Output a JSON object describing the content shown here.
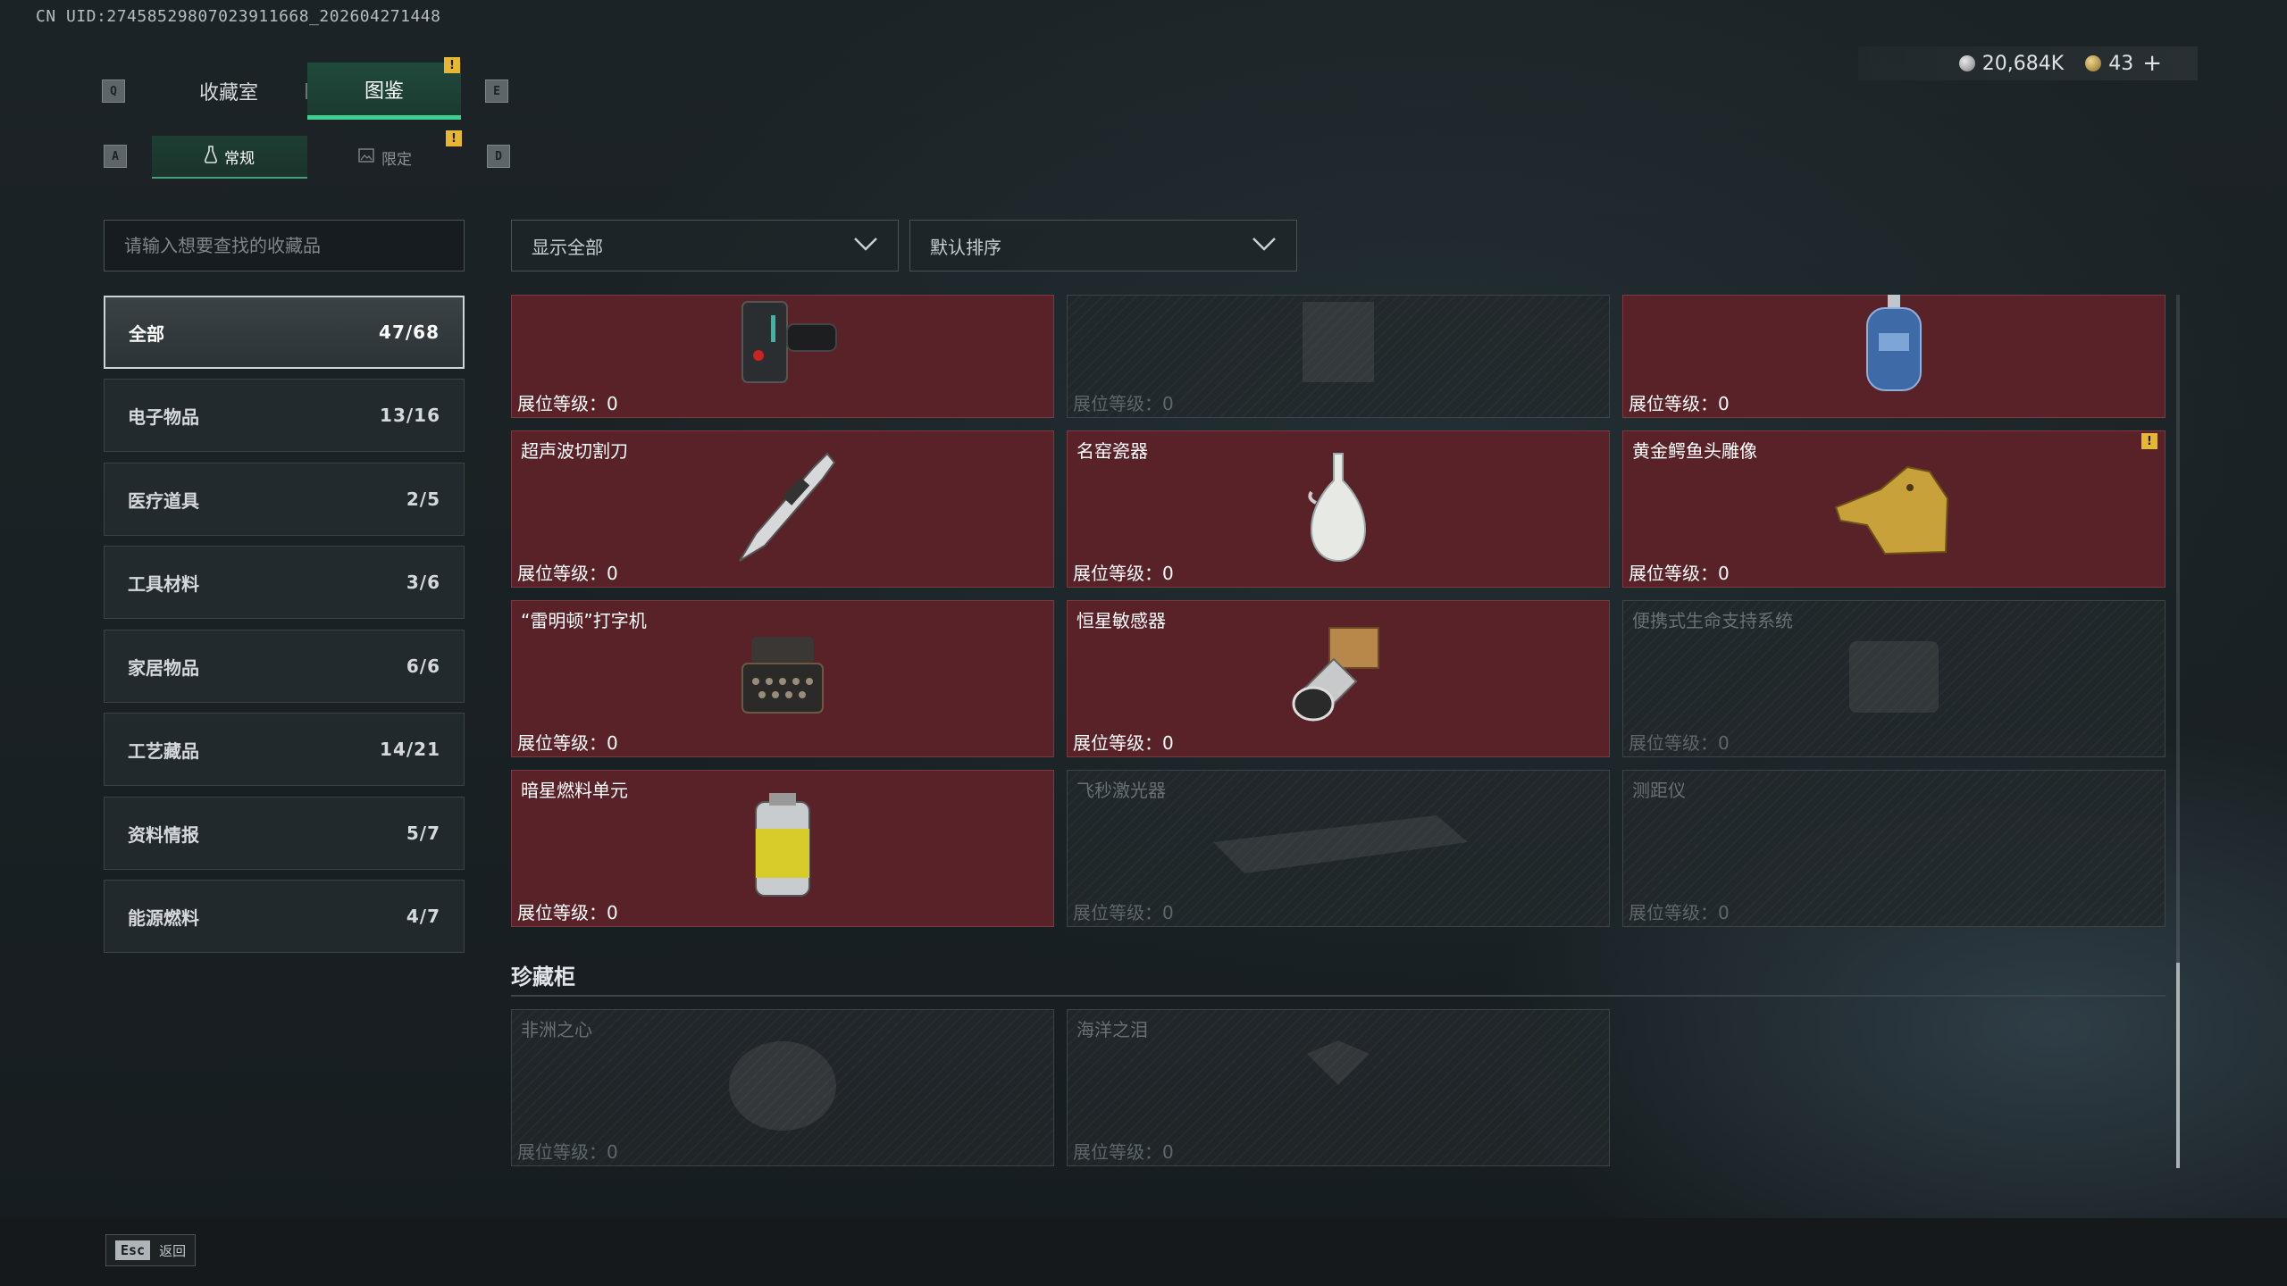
{
  "uid": "CN UID:274585298070239116​68_202604271448",
  "tabs": {
    "left_key": "Q",
    "right_key": "E",
    "items": [
      "收藏室",
      "图鉴"
    ]
  },
  "subtabs": {
    "left_key": "A",
    "right_key": "D",
    "items": [
      "常规",
      "限定"
    ]
  },
  "warn_mark": "!",
  "currency": {
    "silver": "20,684K",
    "gold": "43",
    "add": "+"
  },
  "search": {
    "placeholder": "请输入想要查找的收藏品"
  },
  "filters": {
    "show": "显示全部",
    "sort": "默认排序"
  },
  "categories": [
    {
      "label": "全部",
      "count": "47/68"
    },
    {
      "label": "电子物品",
      "count": "13/16"
    },
    {
      "label": "医疗道具",
      "count": "2/5"
    },
    {
      "label": "工具材料",
      "count": "3/6"
    },
    {
      "label": "家居物品",
      "count": "6/6"
    },
    {
      "label": "工艺藏品",
      "count": "14/21"
    },
    {
      "label": "资料情报",
      "count": "5/7"
    },
    {
      "label": "能源燃料",
      "count": "4/7"
    }
  ],
  "level_label": "展位等级：0",
  "items": [
    {
      "name": "",
      "owned": true,
      "icon": "wrist-device-icon"
    },
    {
      "name": "",
      "owned": false,
      "icon": "crate-icon"
    },
    {
      "name": "",
      "owned": true,
      "icon": "gas-canister-icon"
    },
    {
      "name": "超声波切割刀",
      "owned": true,
      "icon": "ultrasonic-knife-icon"
    },
    {
      "name": "名窑瓷器",
      "owned": true,
      "icon": "porcelain-vase-icon"
    },
    {
      "name": "黄金鳄鱼头雕像",
      "owned": true,
      "icon": "golden-crocodile-icon"
    },
    {
      "name": "“雷明顿”打字机",
      "owned": true,
      "icon": "typewriter-icon"
    },
    {
      "name": "恒星敏感器",
      "owned": true,
      "icon": "star-sensor-icon"
    },
    {
      "name": "便携式生命支持系统",
      "owned": false,
      "icon": "life-support-icon"
    },
    {
      "name": "暗星燃料单元",
      "owned": true,
      "icon": "fuel-cell-icon"
    },
    {
      "name": "飞秒激光器",
      "owned": false,
      "icon": "laser-icon"
    },
    {
      "name": "测距仪",
      "owned": false,
      "icon": "rangefinder-icon"
    }
  ],
  "cabinet": {
    "title": "珍藏柜",
    "items": [
      {
        "name": "非洲之心",
        "owned": false,
        "icon": "diamond-icon"
      },
      {
        "name": "海洋之泪",
        "owned": false,
        "icon": "gem-icon"
      }
    ]
  },
  "footer": {
    "esc_key": "Esc",
    "back_label": "返回"
  }
}
